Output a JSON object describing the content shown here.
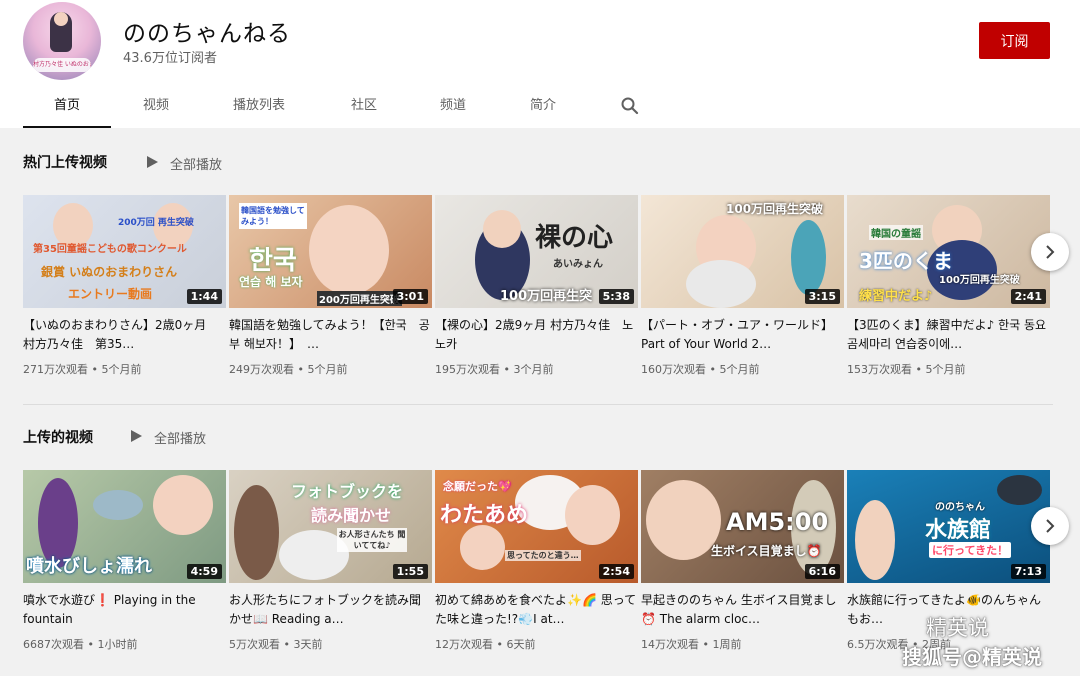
{
  "channel": {
    "name": "ののちゃんねる",
    "subscribers": "43.6万位订阅者",
    "avatar_caption": "村方乃々佳 いぬのおまわり",
    "subscribe_label": "订阅"
  },
  "tabs": [
    {
      "label": "首页",
      "active": true
    },
    {
      "label": "视频"
    },
    {
      "label": "播放列表"
    },
    {
      "label": "社区"
    },
    {
      "label": "频道"
    },
    {
      "label": "简介"
    }
  ],
  "sections": [
    {
      "title": "热门上传视频",
      "play_all": "全部播放",
      "videos": [
        {
          "title": "【いぬのおまわりさん】2歳0ヶ月　村方乃々佳　第35…",
          "views": "271万次观看",
          "age": "5个月前",
          "duration": "1:44",
          "overlay": [
            "200万回 再生突破",
            "第35回童謡こどもの歌コンクール",
            "銀賞 いぬのおまわりさん",
            "エントリー動画"
          ]
        },
        {
          "title": "韓国語を勉強してみよう！【한국　공부 해보자！】　…",
          "views": "249万次观看",
          "age": "5个月前",
          "duration": "3:01",
          "overlay": [
            "韓国語を勉強してみよう！",
            "한국",
            "연습 해 보자",
            "200万回再生突破"
          ]
        },
        {
          "title": "【裸の心】2歳9ヶ月 村方乃々佳　노노카",
          "views": "195万次观看",
          "age": "3个月前",
          "duration": "5:38",
          "overlay": [
            "裸の心",
            "あいみょん",
            "100万回再生突"
          ]
        },
        {
          "title": "【パート・オブ・ユア・ワールド】Part of Your World 2…",
          "views": "160万次观看",
          "age": "5个月前",
          "duration": "3:15",
          "overlay": [
            "100万回再生突破"
          ]
        },
        {
          "title": "【3匹のくま】練習中だよ♪ 한국 동요 곰세마리 연습중이에…",
          "views": "153万次观看",
          "age": "5个月前",
          "duration": "2:41",
          "overlay": [
            "韓国の童謡",
            "3匹のくま",
            "100万回再生突破",
            "練習中だよ♪"
          ]
        }
      ]
    },
    {
      "title": "上传的视频",
      "play_all": "全部播放",
      "videos": [
        {
          "title": "噴水で水遊び❗ Playing in the fountain",
          "views": "6687次观看",
          "age": "1小时前",
          "duration": "4:59",
          "overlay": [
            "噴水びしょ濡れ"
          ]
        },
        {
          "title": "お人形たちにフォトブックを読み聞かせ📖 Reading a…",
          "views": "5万次观看",
          "age": "3天前",
          "duration": "1:55",
          "overlay": [
            "フォトブックを",
            "読み聞かせ",
            "お人形さんたち 聞いててね♪"
          ]
        },
        {
          "title": "初めて綿あめを食べたよ✨🌈 思ってた味と違った!?💨I at…",
          "views": "12万次观看",
          "age": "6天前",
          "duration": "2:54",
          "overlay": [
            "念願だった💖",
            "わたあめ",
            "思ってたのと違う…"
          ]
        },
        {
          "title": "早起きののちゃん 生ボイス目覚まし⏰ The alarm cloc…",
          "views": "14万次观看",
          "age": "1周前",
          "duration": "6:16",
          "overlay": [
            "AM5:00",
            "生ボイス目覚まし⏰"
          ]
        },
        {
          "title": "水族館に行ってきたよ🐠のんちゃんもお…",
          "views": "6.5万次观看",
          "age": "2周前",
          "duration": "7:13",
          "overlay": [
            "ののちゃん",
            "水族館",
            "に行ってきた！"
          ]
        }
      ]
    }
  ],
  "watermark": {
    "line1": "精英说",
    "line2": "搜狐号@精英说"
  },
  "colors": {
    "subscribe_red": "#c00000",
    "page_bg": "#f1f1f1"
  }
}
